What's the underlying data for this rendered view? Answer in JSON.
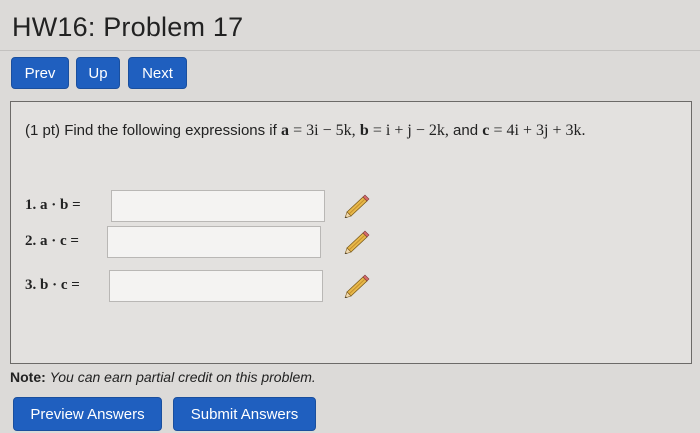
{
  "header": {
    "title": "HW16: Problem 17"
  },
  "nav": {
    "prev_label": "Prev",
    "up_label": "Up",
    "next_label": "Next"
  },
  "problem": {
    "points": "(1 pt)",
    "prompt": "Find the following expressions if",
    "a_name": "a",
    "a_expr": "= 3i − 5k,",
    "b_name": "b",
    "b_expr": "= i + j − 2k,",
    "and_word": "and",
    "c_name": "c",
    "c_expr": "= 4i + 3j + 3k."
  },
  "parts": [
    {
      "label": "1. a · b =",
      "value": "",
      "icon": "pencil-icon"
    },
    {
      "label": "2. a · c =",
      "value": "",
      "icon": "pencil-icon"
    },
    {
      "label": "3. b · c =",
      "value": "",
      "icon": "pencil-icon"
    }
  ],
  "note": {
    "label": "Note:",
    "text": "You can earn partial credit on this problem."
  },
  "actions": {
    "preview_label": "Preview Answers",
    "submit_label": "Submit Answers"
  },
  "colors": {
    "button_blue": "#1f5fbf",
    "background": "#dcdad8",
    "pencil_yellow": "#e8b84a"
  }
}
